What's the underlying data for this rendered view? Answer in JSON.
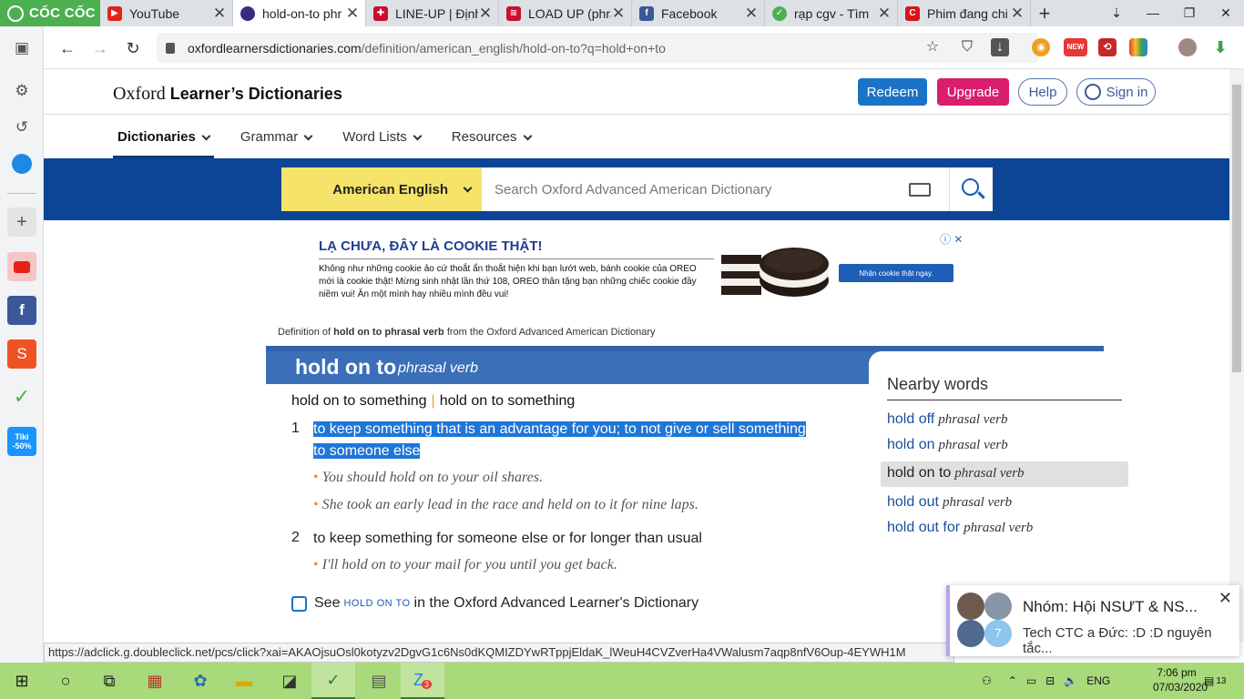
{
  "browser": {
    "brand": "CỐC CỐC",
    "tabs": [
      {
        "title": "YouTube",
        "color": "#e62117",
        "glyph": "▶"
      },
      {
        "title": "hold-on-to phr",
        "color": "#3a2a80",
        "glyph": "◐"
      },
      {
        "title": "LINE-UP | Định",
        "color": "#c8102e",
        "glyph": "✚"
      },
      {
        "title": "LOAD UP (phra",
        "color": "#c8102e",
        "glyph": "≋"
      },
      {
        "title": "Facebook",
        "color": "#3b5998",
        "glyph": "f"
      },
      {
        "title": "rạp cgv - Tìm",
        "color": "#4caf50",
        "glyph": "✓"
      },
      {
        "title": "Phim đang chi",
        "color": "#d8141b",
        "glyph": "C"
      }
    ],
    "url_domain": "oxfordlearnersdictionaries.com",
    "url_path": "/definition/american_english/hold-on-to?q=hold+on+to",
    "ext_new_label": "NEW"
  },
  "sidebar": {
    "icons": [
      "panel-icon",
      "gear-icon",
      "history-icon",
      "messenger-icon",
      "add-icon",
      "youtube-icon",
      "facebook-icon",
      "shopee-icon",
      "coccoc-icon",
      "tiki-icon"
    ],
    "tiki_label": "Tiki -50%"
  },
  "site": {
    "logo_prefix": "Oxford",
    "logo_bold": "Learner’s Dictionaries",
    "redeem": "Redeem",
    "upgrade": "Upgrade",
    "help": "Help",
    "signin": "Sign in",
    "nav": [
      "Dictionaries",
      "Grammar",
      "Word Lists",
      "Resources"
    ],
    "dict_select": "American English",
    "search_placeholder": "Search Oxford Advanced American Dictionary"
  },
  "ad": {
    "title": "LẠ CHƯA, ĐÂY LÀ COOKIE THẬT!",
    "text": "Không như những cookie ảo cứ thoắt ẩn thoắt hiện khi bạn lướt web, bánh cookie của OREO mới là cookie thật! Mừng sinh nhật lần thứ 108, OREO thân tặng bạn những chiếc cookie đầy niềm vui! Ăn một mình hay nhiều mình đều vui!",
    "button": "Nhận cookie thật ngay."
  },
  "entry": {
    "crumb_pre": "Definition of",
    "crumb_bold": "hold on to phrasal verb",
    "crumb_post": "from the Oxford Advanced American Dictionary",
    "headword": "hold on to",
    "pos": "phrasal verb",
    "variant_1": "hold on to something",
    "variant_sep": "|",
    "variant_2": "hold on to something",
    "senses": [
      {
        "num": "1",
        "def_line1": "to keep something that is an advantage for you; to not give or sell something",
        "def_line2": "to someone else",
        "examples": [
          "You should hold on to your oil shares.",
          "She took an early lead in the race and held on to it for nine laps."
        ]
      },
      {
        "num": "2",
        "def_line1": "to keep something for someone else or for longer than usual",
        "examples": [
          "I'll hold on to your mail for you until you get back."
        ]
      }
    ],
    "see_pre": "See",
    "see_term": "HOLD ON TO",
    "see_post": "in the Oxford Advanced Learner's Dictionary"
  },
  "nearby": {
    "title": "Nearby words",
    "items": [
      {
        "word": "hold off",
        "pos": "phrasal verb"
      },
      {
        "word": "hold on",
        "pos": "phrasal verb"
      },
      {
        "word": "hold on to",
        "pos": "phrasal verb"
      },
      {
        "word": "hold out",
        "pos": "phrasal verb"
      },
      {
        "word": "hold out for",
        "pos": "phrasal verb"
      }
    ]
  },
  "statusbar": "https://adclick.g.doubleclick.net/pcs/click?xai=AKAOjsuOsl0kotyzv2DgvG1c6Ns0dKQMIZDYwRTppjEldaK_lWeuH4CVZverHa4VWalusm7aqp8nfV6Oup-4EYWH1M",
  "notification": {
    "title": "Nhóm: Hội NSƯT & NS...",
    "message": "Tech CTC a Đức: :D :D nguyên tắc...",
    "count": "7"
  },
  "taskbar": {
    "zalo_badge": "3",
    "language": "ENG",
    "time": "7:06 pm",
    "date": "07/03/2020",
    "notif_count": "13"
  }
}
